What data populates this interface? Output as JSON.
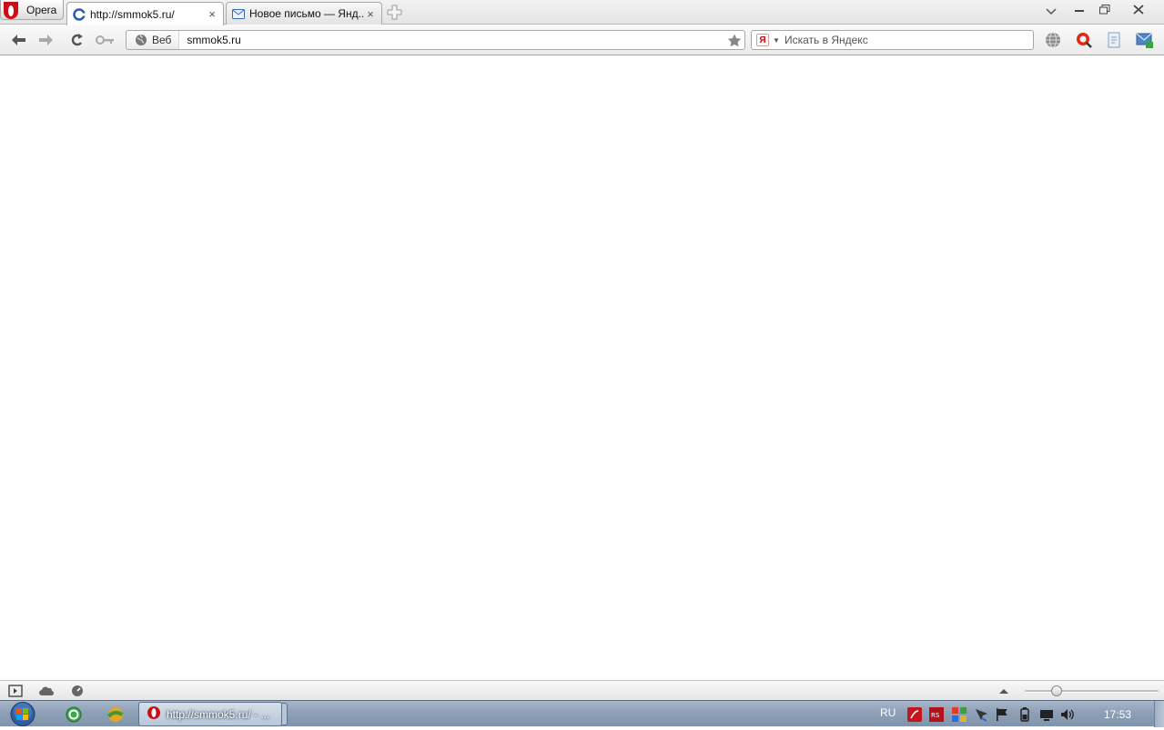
{
  "browser": {
    "menu_label": "Opera",
    "tabs": [
      {
        "title": "http://smmok5.ru/",
        "favicon": "loading-icon",
        "active": true
      },
      {
        "title": "Новое письмо — Янд...",
        "favicon": "mail-icon",
        "active": false
      }
    ],
    "close_glyph": "×"
  },
  "address_bar": {
    "badge_label": "Веб",
    "url": "smmok5.ru"
  },
  "search": {
    "engine_letter": "Я",
    "placeholder": "Искать в Яндекс"
  },
  "taskbar": {
    "window_title": "http://smmok5.ru/ - ...",
    "language": "RU",
    "clock": "17:53"
  },
  "statusbar": {
    "zoom_level_fraction": 0.24
  },
  "colors": {
    "opera_red": "#cc0f16",
    "taskbar_blue": "#8da0b7"
  }
}
